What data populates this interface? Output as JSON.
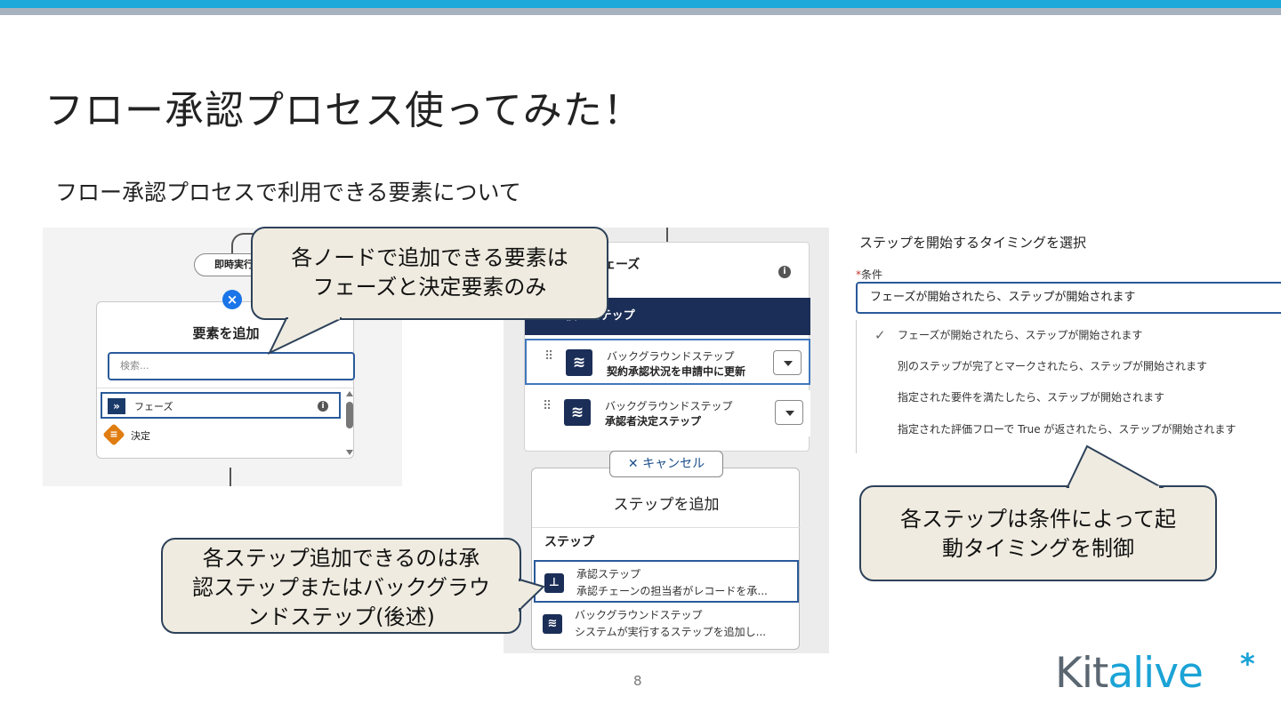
{
  "slide": {
    "title": "フロー承認プロセス使ってみた！",
    "subtitle": "フロー承認プロセスで利用できる要素について",
    "page_number": "8",
    "colors": {
      "accent_bar": "#1da9d9",
      "callout_fill": "#efebe0",
      "callout_border": "#2d4159",
      "brand_blue": "#1ba3d6",
      "brand_gray": "#5a6670"
    }
  },
  "panel_add_element": {
    "pill_label": "即時実行",
    "close_icon": "close-icon",
    "title": "要素を追加",
    "search_placeholder": "検索...",
    "items": [
      {
        "icon": "phase-chevrons-icon",
        "label": "フェーズ",
        "info_icon": "info-icon"
      },
      {
        "icon": "decision-diamond-icon",
        "label": "決定"
      }
    ]
  },
  "panel_steps": {
    "phase_title": "前フェーズ",
    "phase_subtitle": "ーズ",
    "step_count_header": "2 個のステップ",
    "steps": [
      {
        "type": "バックグラウンドステップ",
        "name": "契約承認状況を申請中に更新"
      },
      {
        "type": "バックグラウンドステップ",
        "name": "承認者決定ステップ"
      }
    ],
    "cancel_button": "✕ キャンセル",
    "add_title": "ステップを追加",
    "add_section": "ステップ",
    "add_items": [
      {
        "title": "承認ステップ",
        "desc": "承認チェーンの担当者がレコードを承..."
      },
      {
        "title": "バックグラウンドステップ",
        "desc": "システムが実行するステップを追加し..."
      }
    ]
  },
  "panel_timing": {
    "title": "ステップを開始するタイミングを選択",
    "required_mark": "*",
    "condition_label": "条件",
    "selected_value": "フェーズが開始されたら、ステップが開始されます",
    "options": [
      "フェーズが開始されたら、ステップが開始されます",
      "別のステップが完了とマークされたら、ステップが開始されます",
      "指定された要件を満たしたら、ステップが開始されます",
      "指定された評価フローで True が返されたら、ステップが開始されます"
    ]
  },
  "callouts": {
    "node_elements": [
      "各ノードで追加できる要素は",
      "フェーズと決定要素のみ"
    ],
    "step_types": [
      "各ステップ追加できるのは承",
      "認ステップまたはバックグラウ",
      "ンドステップ(後述)"
    ],
    "step_timing": [
      "各ステップは条件によって起",
      "動タイミングを制御"
    ]
  },
  "logo": {
    "kit": "Kit",
    "alive": "alive",
    "star": "*"
  }
}
